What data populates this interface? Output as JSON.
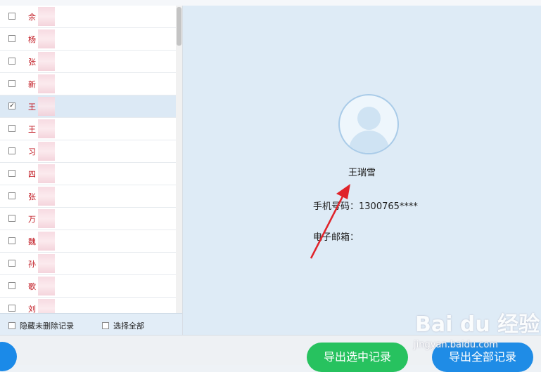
{
  "contacts": [
    {
      "name": "余",
      "checked": false,
      "selected": false
    },
    {
      "name": "杨",
      "checked": false,
      "selected": false
    },
    {
      "name": "张",
      "checked": false,
      "selected": false
    },
    {
      "name": "新",
      "checked": false,
      "selected": false
    },
    {
      "name": "王",
      "checked": true,
      "selected": true
    },
    {
      "name": "王",
      "checked": false,
      "selected": false
    },
    {
      "name": "习",
      "checked": false,
      "selected": false
    },
    {
      "name": "四",
      "checked": false,
      "selected": false
    },
    {
      "name": "张",
      "checked": false,
      "selected": false
    },
    {
      "name": "万",
      "checked": false,
      "selected": false
    },
    {
      "name": "魏",
      "checked": false,
      "selected": false
    },
    {
      "name": "孙",
      "checked": false,
      "selected": false
    },
    {
      "name": "歌",
      "checked": false,
      "selected": false
    },
    {
      "name": "刘",
      "checked": false,
      "selected": false
    }
  ],
  "left_footer": {
    "hide_deleted_label": "隐藏未删除记录",
    "select_all_label": "选择全部"
  },
  "detail": {
    "name": "王瑞雪",
    "phone_label": "手机号码：",
    "phone_value": "1300765****",
    "email_label": "电子邮箱：",
    "email_value": ""
  },
  "buttons": {
    "export_selected": "导出选中记录",
    "export_all": "导出全部记录"
  },
  "watermark": {
    "logo": "Bai du 经验",
    "url": "jingyan.baidu.com"
  },
  "colors": {
    "accent_red": "#c0131c",
    "selected_row": "#dce9f5",
    "green_button": "#27c25f",
    "blue_button": "#1f8ce6"
  }
}
